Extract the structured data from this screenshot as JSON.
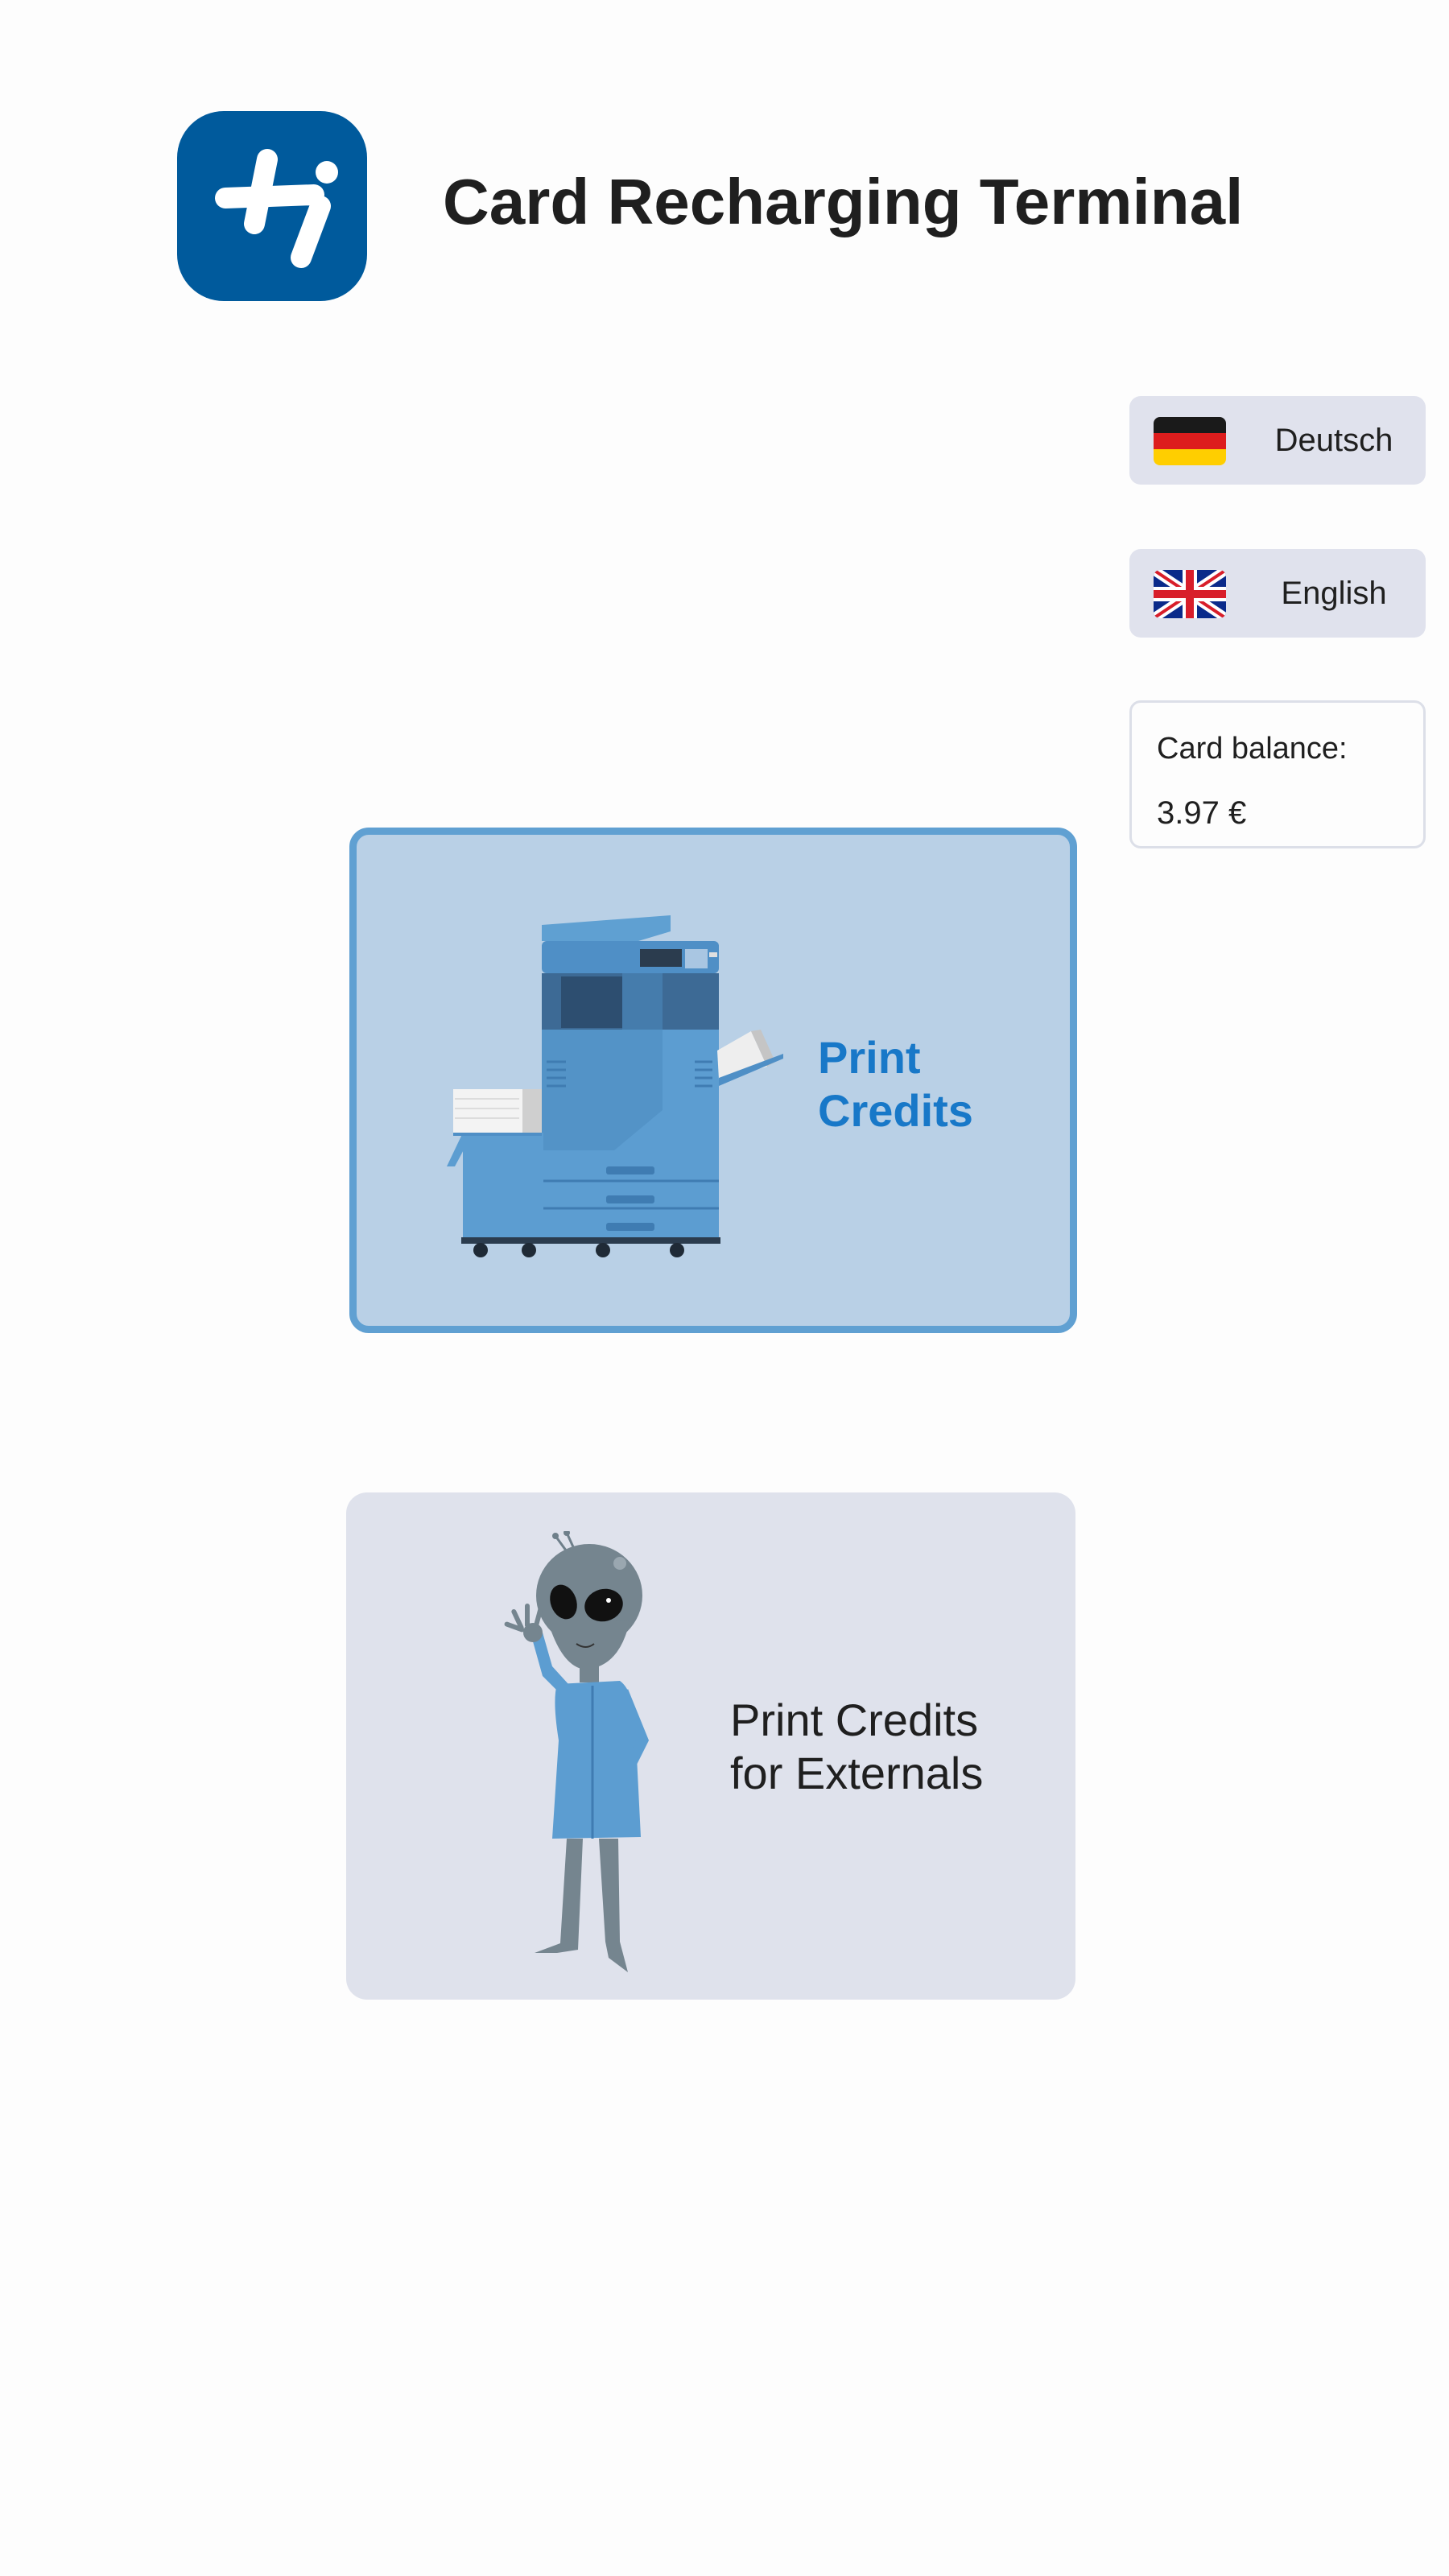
{
  "header": {
    "title": "Card Recharging Terminal",
    "logo_icon": "university-logo-icon",
    "logo_color": "#005a9c"
  },
  "languages": [
    {
      "label": "Deutsch",
      "icon": "germany-flag-icon"
    },
    {
      "label": "English",
      "icon": "uk-flag-icon"
    }
  ],
  "balance": {
    "label": "Card balance:",
    "value": "3.97 €"
  },
  "options": [
    {
      "label": "Print\nCredits",
      "icon": "printer-icon",
      "selected": true,
      "accent": "#1878c8"
    },
    {
      "label": "Print Credits\nfor Externals",
      "icon": "alien-icon",
      "selected": false
    }
  ]
}
